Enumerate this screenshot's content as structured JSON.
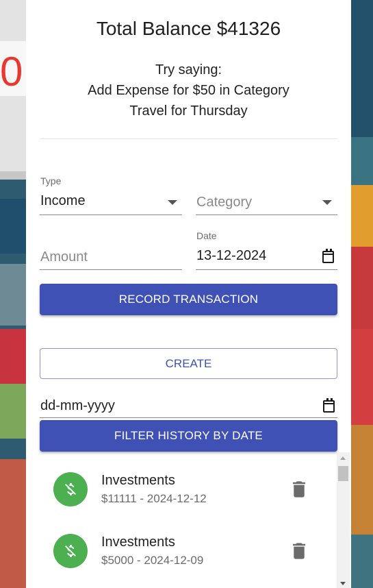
{
  "balance": {
    "text": "Total Balance $41326"
  },
  "hint": {
    "line1": "Try saying:",
    "line2": "Add Expense for $50 in Category",
    "line3": "Travel for Thursday"
  },
  "form": {
    "type_label": "Type",
    "type_value": "Income",
    "category_placeholder": "Category",
    "amount_placeholder": "Amount",
    "date_label": "Date",
    "date_value": "13-12-2024",
    "record_button": "RECORD TRANSACTION"
  },
  "create_button": "CREATE",
  "filter": {
    "date_placeholder": "dd-mm-yyyy",
    "button": "FILTER HISTORY BY DATE"
  },
  "history": {
    "items": [
      {
        "title": "Investments",
        "subtitle": "$11111 - 2024-12-12"
      },
      {
        "title": "Investments",
        "subtitle": "$5000 - 2024-12-09"
      }
    ]
  },
  "colors": {
    "primary": "#3f51b5",
    "income_avatar": "#4caf50",
    "card": "#ffffff"
  },
  "icons": [
    "dropdown-caret-icon",
    "calendar-icon",
    "money-off-icon",
    "trash-icon"
  ]
}
